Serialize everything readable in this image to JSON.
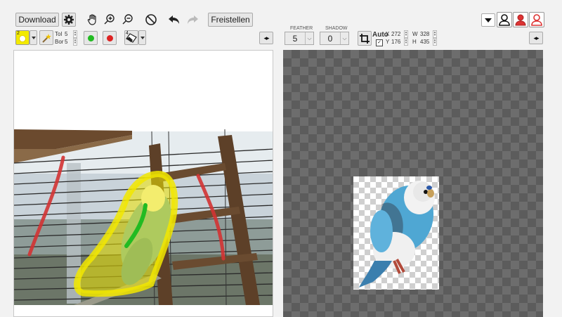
{
  "toolbar": {
    "download_label": "Download",
    "freistellen_label": "Freistellen",
    "brush_size_badge": "2",
    "eraser_size_badge": "4",
    "tol_label": "Tol",
    "tol_value": "5",
    "bor_label": "Bor",
    "bor_value": "5",
    "feather_label": "FEATHER",
    "feather_value": "5",
    "shadow_label": "SHADOW",
    "shadow_value": "0",
    "auto_label": "Auto",
    "crop": {
      "x_label": "X",
      "x_value": "272",
      "y_label": "Y",
      "y_value": "176",
      "w_label": "W",
      "w_value": "328",
      "h_label": "H",
      "h_value": "435"
    },
    "auto_checked": true
  },
  "icons": {
    "settings": "gear-icon",
    "pan": "hand-icon",
    "zoom_in": "zoom-in-icon",
    "zoom_out": "zoom-out-icon",
    "reset": "no-entry-icon",
    "undo": "undo-icon",
    "redo": "redo-icon",
    "wand": "magic-wand-icon",
    "eraser": "eraser-icon",
    "crop": "crop-icon",
    "expand": "expand-horizontal-icon",
    "user": "user-icon"
  },
  "colors": {
    "keep_marker": "#22bb22",
    "remove_marker": "#dd2222",
    "highlight": "#f2e800",
    "accent_red": "#d33333"
  }
}
